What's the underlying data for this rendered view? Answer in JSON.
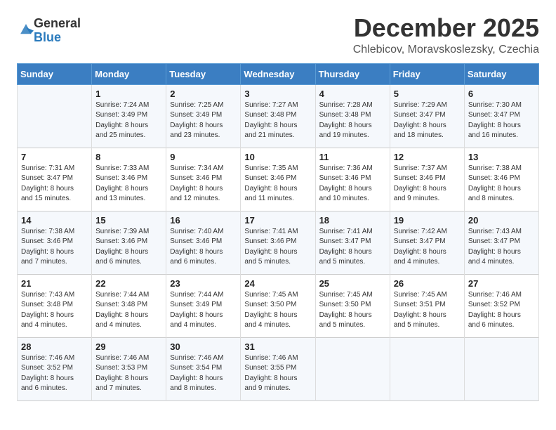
{
  "logo": {
    "general": "General",
    "blue": "Blue"
  },
  "title": "December 2025",
  "subtitle": "Chlebicov, Moravskoslezsky, Czechia",
  "days_header": [
    "Sunday",
    "Monday",
    "Tuesday",
    "Wednesday",
    "Thursday",
    "Friday",
    "Saturday"
  ],
  "weeks": [
    [
      {
        "day": "",
        "info": ""
      },
      {
        "day": "1",
        "info": "Sunrise: 7:24 AM\nSunset: 3:49 PM\nDaylight: 8 hours\nand 25 minutes."
      },
      {
        "day": "2",
        "info": "Sunrise: 7:25 AM\nSunset: 3:49 PM\nDaylight: 8 hours\nand 23 minutes."
      },
      {
        "day": "3",
        "info": "Sunrise: 7:27 AM\nSunset: 3:48 PM\nDaylight: 8 hours\nand 21 minutes."
      },
      {
        "day": "4",
        "info": "Sunrise: 7:28 AM\nSunset: 3:48 PM\nDaylight: 8 hours\nand 19 minutes."
      },
      {
        "day": "5",
        "info": "Sunrise: 7:29 AM\nSunset: 3:47 PM\nDaylight: 8 hours\nand 18 minutes."
      },
      {
        "day": "6",
        "info": "Sunrise: 7:30 AM\nSunset: 3:47 PM\nDaylight: 8 hours\nand 16 minutes."
      }
    ],
    [
      {
        "day": "7",
        "info": "Sunrise: 7:31 AM\nSunset: 3:47 PM\nDaylight: 8 hours\nand 15 minutes."
      },
      {
        "day": "8",
        "info": "Sunrise: 7:33 AM\nSunset: 3:46 PM\nDaylight: 8 hours\nand 13 minutes."
      },
      {
        "day": "9",
        "info": "Sunrise: 7:34 AM\nSunset: 3:46 PM\nDaylight: 8 hours\nand 12 minutes."
      },
      {
        "day": "10",
        "info": "Sunrise: 7:35 AM\nSunset: 3:46 PM\nDaylight: 8 hours\nand 11 minutes."
      },
      {
        "day": "11",
        "info": "Sunrise: 7:36 AM\nSunset: 3:46 PM\nDaylight: 8 hours\nand 10 minutes."
      },
      {
        "day": "12",
        "info": "Sunrise: 7:37 AM\nSunset: 3:46 PM\nDaylight: 8 hours\nand 9 minutes."
      },
      {
        "day": "13",
        "info": "Sunrise: 7:38 AM\nSunset: 3:46 PM\nDaylight: 8 hours\nand 8 minutes."
      }
    ],
    [
      {
        "day": "14",
        "info": "Sunrise: 7:38 AM\nSunset: 3:46 PM\nDaylight: 8 hours\nand 7 minutes."
      },
      {
        "day": "15",
        "info": "Sunrise: 7:39 AM\nSunset: 3:46 PM\nDaylight: 8 hours\nand 6 minutes."
      },
      {
        "day": "16",
        "info": "Sunrise: 7:40 AM\nSunset: 3:46 PM\nDaylight: 8 hours\nand 6 minutes."
      },
      {
        "day": "17",
        "info": "Sunrise: 7:41 AM\nSunset: 3:46 PM\nDaylight: 8 hours\nand 5 minutes."
      },
      {
        "day": "18",
        "info": "Sunrise: 7:41 AM\nSunset: 3:47 PM\nDaylight: 8 hours\nand 5 minutes."
      },
      {
        "day": "19",
        "info": "Sunrise: 7:42 AM\nSunset: 3:47 PM\nDaylight: 8 hours\nand 4 minutes."
      },
      {
        "day": "20",
        "info": "Sunrise: 7:43 AM\nSunset: 3:47 PM\nDaylight: 8 hours\nand 4 minutes."
      }
    ],
    [
      {
        "day": "21",
        "info": "Sunrise: 7:43 AM\nSunset: 3:48 PM\nDaylight: 8 hours\nand 4 minutes."
      },
      {
        "day": "22",
        "info": "Sunrise: 7:44 AM\nSunset: 3:48 PM\nDaylight: 8 hours\nand 4 minutes."
      },
      {
        "day": "23",
        "info": "Sunrise: 7:44 AM\nSunset: 3:49 PM\nDaylight: 8 hours\nand 4 minutes."
      },
      {
        "day": "24",
        "info": "Sunrise: 7:45 AM\nSunset: 3:50 PM\nDaylight: 8 hours\nand 4 minutes."
      },
      {
        "day": "25",
        "info": "Sunrise: 7:45 AM\nSunset: 3:50 PM\nDaylight: 8 hours\nand 5 minutes."
      },
      {
        "day": "26",
        "info": "Sunrise: 7:45 AM\nSunset: 3:51 PM\nDaylight: 8 hours\nand 5 minutes."
      },
      {
        "day": "27",
        "info": "Sunrise: 7:46 AM\nSunset: 3:52 PM\nDaylight: 8 hours\nand 6 minutes."
      }
    ],
    [
      {
        "day": "28",
        "info": "Sunrise: 7:46 AM\nSunset: 3:52 PM\nDaylight: 8 hours\nand 6 minutes."
      },
      {
        "day": "29",
        "info": "Sunrise: 7:46 AM\nSunset: 3:53 PM\nDaylight: 8 hours\nand 7 minutes."
      },
      {
        "day": "30",
        "info": "Sunrise: 7:46 AM\nSunset: 3:54 PM\nDaylight: 8 hours\nand 8 minutes."
      },
      {
        "day": "31",
        "info": "Sunrise: 7:46 AM\nSunset: 3:55 PM\nDaylight: 8 hours\nand 9 minutes."
      },
      {
        "day": "",
        "info": ""
      },
      {
        "day": "",
        "info": ""
      },
      {
        "day": "",
        "info": ""
      }
    ]
  ]
}
